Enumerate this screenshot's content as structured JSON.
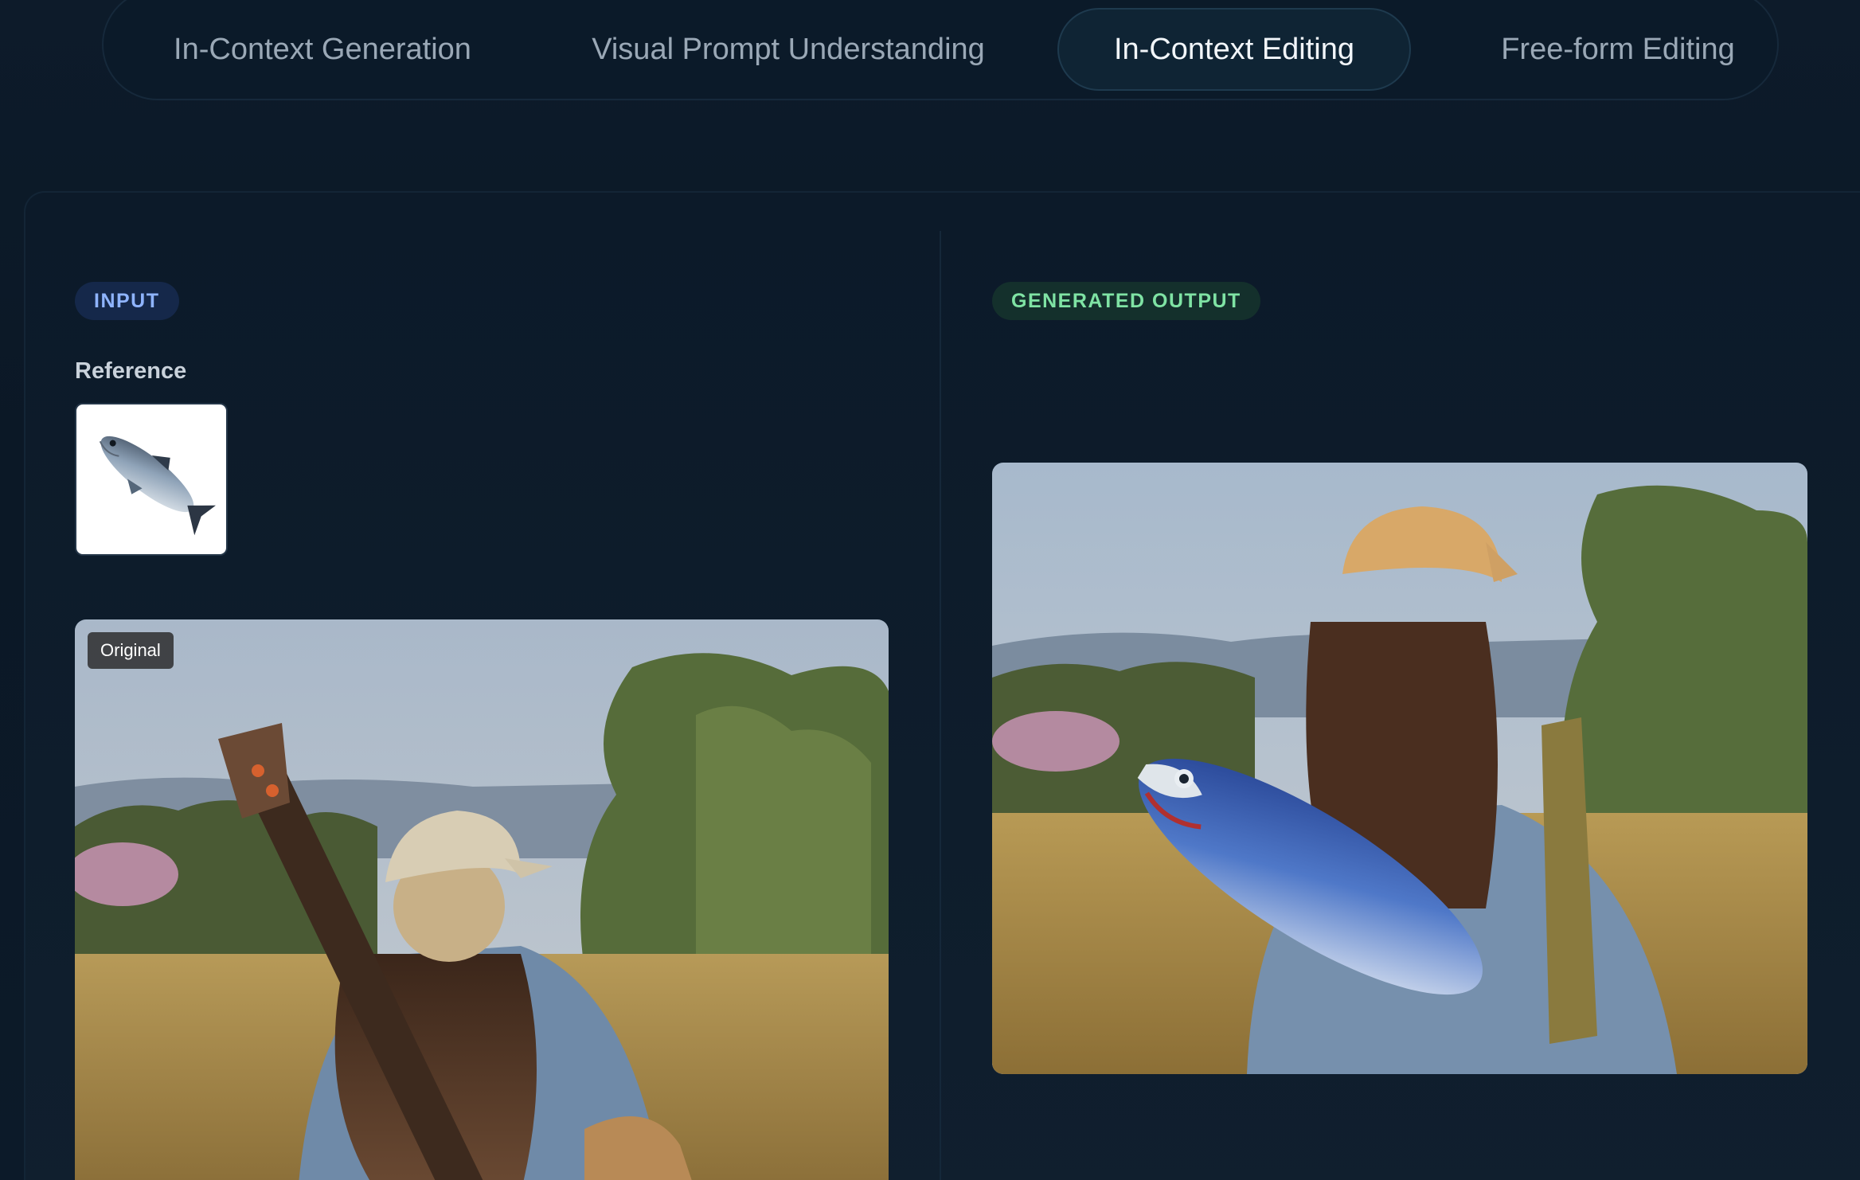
{
  "tabs": [
    {
      "label": "In-Context Generation",
      "active": false
    },
    {
      "label": "Visual Prompt Understanding",
      "active": false
    },
    {
      "label": "In-Context Editing",
      "active": true
    },
    {
      "label": "Free-form Editing",
      "active": false
    }
  ],
  "input_panel": {
    "tag": "INPUT",
    "reference_label": "Reference",
    "original_badge": "Original"
  },
  "output_panel": {
    "tag": "GENERATED OUTPUT"
  },
  "colors": {
    "background": "#0c1826",
    "input_tag": "#8fb4ff",
    "output_tag": "#7fe3a4",
    "active_tab_text": "#f2f6fa"
  }
}
